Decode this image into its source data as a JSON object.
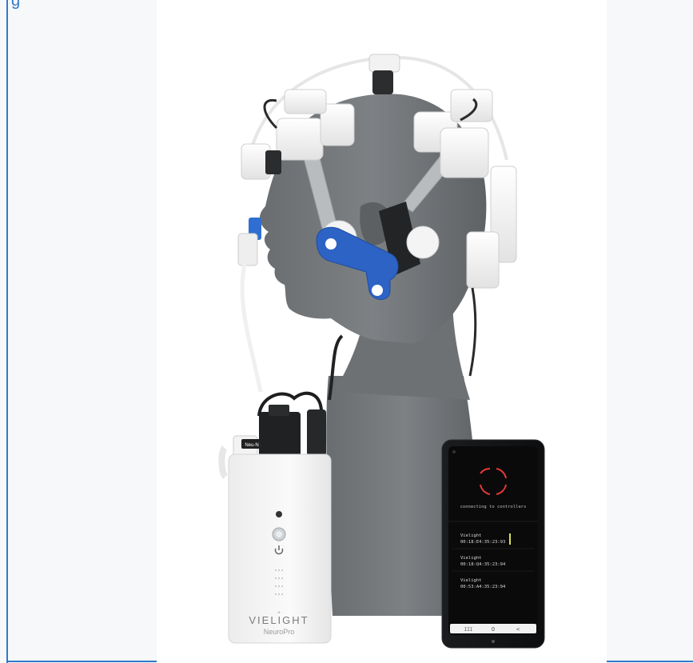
{
  "page": {
    "top_link_text": "g"
  },
  "photo": {
    "device_brand": "VIELIGHT",
    "device_model": "NeuroPro",
    "tag_label": "Neu-N",
    "phone": {
      "status": "connecting to controllers",
      "devices": [
        {
          "name": "Vielight",
          "id": "00:18:E4:35:23:93"
        },
        {
          "name": "Vielight",
          "id": "00:18:Q4:35:23:94"
        },
        {
          "name": "Vielight",
          "id": "00:53:A4:35:23:94"
        }
      ],
      "nav": [
        "III",
        "O",
        "<"
      ]
    }
  },
  "colors": {
    "accent_blue": "#2f79c9",
    "mannequin_gray": "#727679",
    "module_white": "#f1f1f1",
    "clip_blue": "#2d63c5",
    "phone_black": "#101214",
    "ring_red": "#e53935"
  }
}
